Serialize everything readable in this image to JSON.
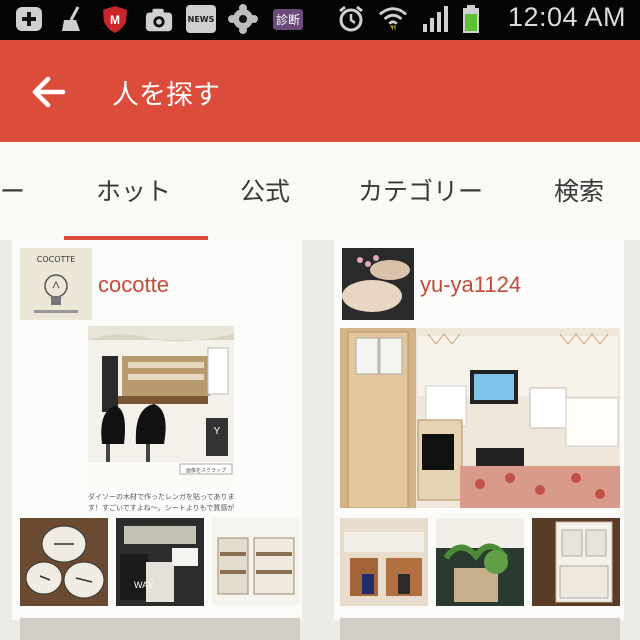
{
  "statusbar": {
    "time": "12:04 AM",
    "news_label": "NEWS",
    "shindan_label": "診断"
  },
  "appbar": {
    "title": "人を探す"
  },
  "tabs": [
    {
      "label": "ー"
    },
    {
      "label": "ホット"
    },
    {
      "label": "公式"
    },
    {
      "label": "カテゴリー"
    },
    {
      "label": "検索"
    }
  ],
  "cards": [
    {
      "username": "cocotte",
      "caption": "ダイソーの木材で作ったレンガを貼ってあります！すごいですよね〜。シートよりもで質感があっ",
      "clip_label": "画像をスクラップ",
      "logo_text": "COCOTTE"
    },
    {
      "username": "yu-ya1124"
    }
  ],
  "colors": {
    "accent": "#dc4c3b",
    "username": "#c24b3c"
  }
}
